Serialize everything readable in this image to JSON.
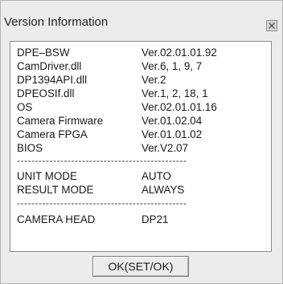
{
  "window": {
    "title": "Version Information"
  },
  "info": [
    {
      "label": "DPE–BSW",
      "value": "Ver.02.01.01.92"
    },
    {
      "label": "CamDriver.dll",
      "value": "Ver.6, 1, 9, 7"
    },
    {
      "label": "DP1394API.dll",
      "value": "Ver.2"
    },
    {
      "label": "DPEOSIf.dll",
      "value": "Ver.1, 2, 18, 1"
    },
    {
      "label": "OS",
      "value": "Ver.02.01.01.16"
    },
    {
      "label": "Camera Firmware",
      "value": "Ver.01.02.04"
    },
    {
      "label": "Camera FPGA",
      "value": "Ver.01.01.02"
    },
    {
      "label": "BIOS",
      "value": "Ver.V2.07"
    }
  ],
  "separator": "-----------------------------------------------",
  "modes": [
    {
      "label": "UNIT MODE",
      "value": "AUTO"
    },
    {
      "label": "RESULT MODE",
      "value": "ALWAYS"
    }
  ],
  "head": {
    "label": "CAMERA HEAD",
    "value": "DP21"
  },
  "ok_button": {
    "label": "OK(SET/OK)"
  }
}
